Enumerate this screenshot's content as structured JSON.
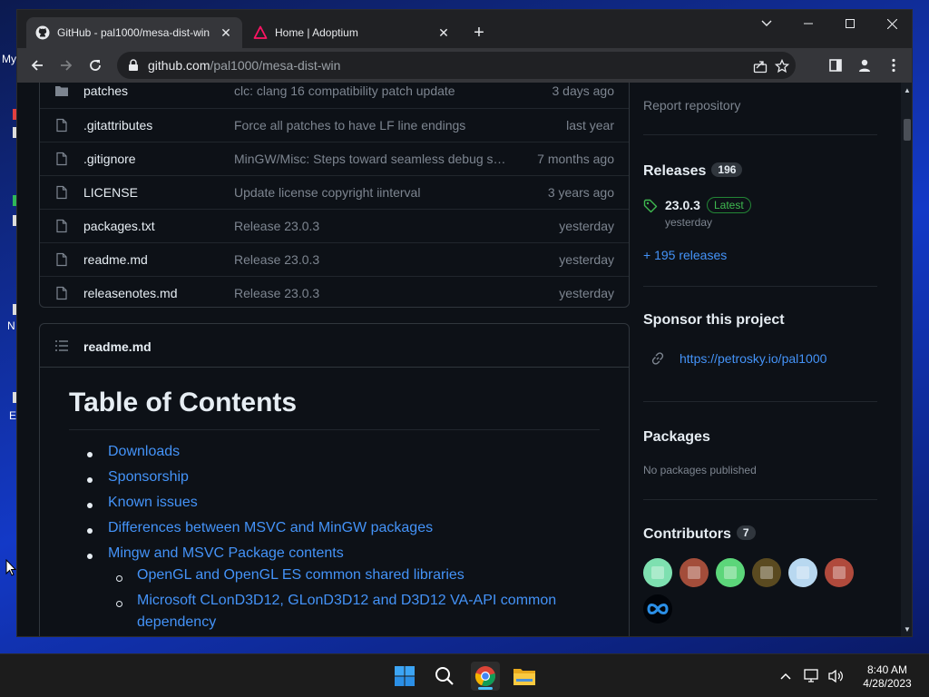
{
  "desktop": {
    "fragments": [
      "My",
      "N",
      "E"
    ]
  },
  "browser": {
    "tabs": [
      {
        "title": "GitHub - pal1000/mesa-dist-win",
        "active": true
      },
      {
        "title": "Home | Adoptium",
        "active": false
      }
    ],
    "url_host": "github.com",
    "url_path": "/pal1000/mesa-dist-win"
  },
  "files": [
    {
      "type": "folder",
      "name": "patches",
      "message": "clc: clang 16 compatibility patch update",
      "date": "3 days ago"
    },
    {
      "type": "file",
      "name": ".gitattributes",
      "message": "Force all patches to have LF line endings",
      "date": "last year"
    },
    {
      "type": "file",
      "name": ".gitignore",
      "message": "MinGW/Misc: Steps toward seamless debug sy…",
      "date": "7 months ago"
    },
    {
      "type": "file",
      "name": "LICENSE",
      "message": "Update license copyright iinterval",
      "date": "3 years ago"
    },
    {
      "type": "file",
      "name": "packages.txt",
      "message": "Release 23.0.3",
      "date": "yesterday"
    },
    {
      "type": "file",
      "name": "readme.md",
      "message": "Release 23.0.3",
      "date": "yesterday"
    },
    {
      "type": "file",
      "name": "releasenotes.md",
      "message": "Release 23.0.3",
      "date": "yesterday"
    }
  ],
  "readme": {
    "filename": "readme.md",
    "heading": "Table of Contents",
    "toc": [
      {
        "label": "Downloads",
        "level": 1
      },
      {
        "label": "Sponsorship",
        "level": 1
      },
      {
        "label": "Known issues",
        "level": 1
      },
      {
        "label": "Differences between MSVC and MinGW packages",
        "level": 1
      },
      {
        "label": "Mingw and MSVC Package contents",
        "level": 1
      },
      {
        "label": "OpenGL and OpenGL ES common shared libraries",
        "level": 2
      },
      {
        "label": "Microsoft CLonD3D12, GLonD3D12 and D3D12 VA-API common",
        "level": 2
      },
      {
        "label": "dependency",
        "level": 3
      }
    ]
  },
  "sidebar": {
    "report": "Report repository",
    "releases_title": "Releases",
    "releases_count": "196",
    "latest_version": "23.0.3",
    "latest_badge": "Latest",
    "latest_date": "yesterday",
    "more_releases": "+ 195 releases",
    "sponsor_title": "Sponsor this project",
    "sponsor_link": "https://petrosky.io/pal1000",
    "packages_title": "Packages",
    "packages_empty": "No packages published",
    "contributors_title": "Contributors",
    "contributors_count": "7",
    "contributor_colors": [
      "#7ee0b0",
      "#a34d3a",
      "#5cd67a",
      "#5a4a20",
      "#b8d8f0",
      "#b04a3c"
    ]
  },
  "taskbar": {
    "time": "8:40 AM",
    "date": "4/28/2023"
  },
  "colors": {
    "link": "#4493f8",
    "muted": "#7d8590",
    "latest_green": "#3fb950"
  }
}
